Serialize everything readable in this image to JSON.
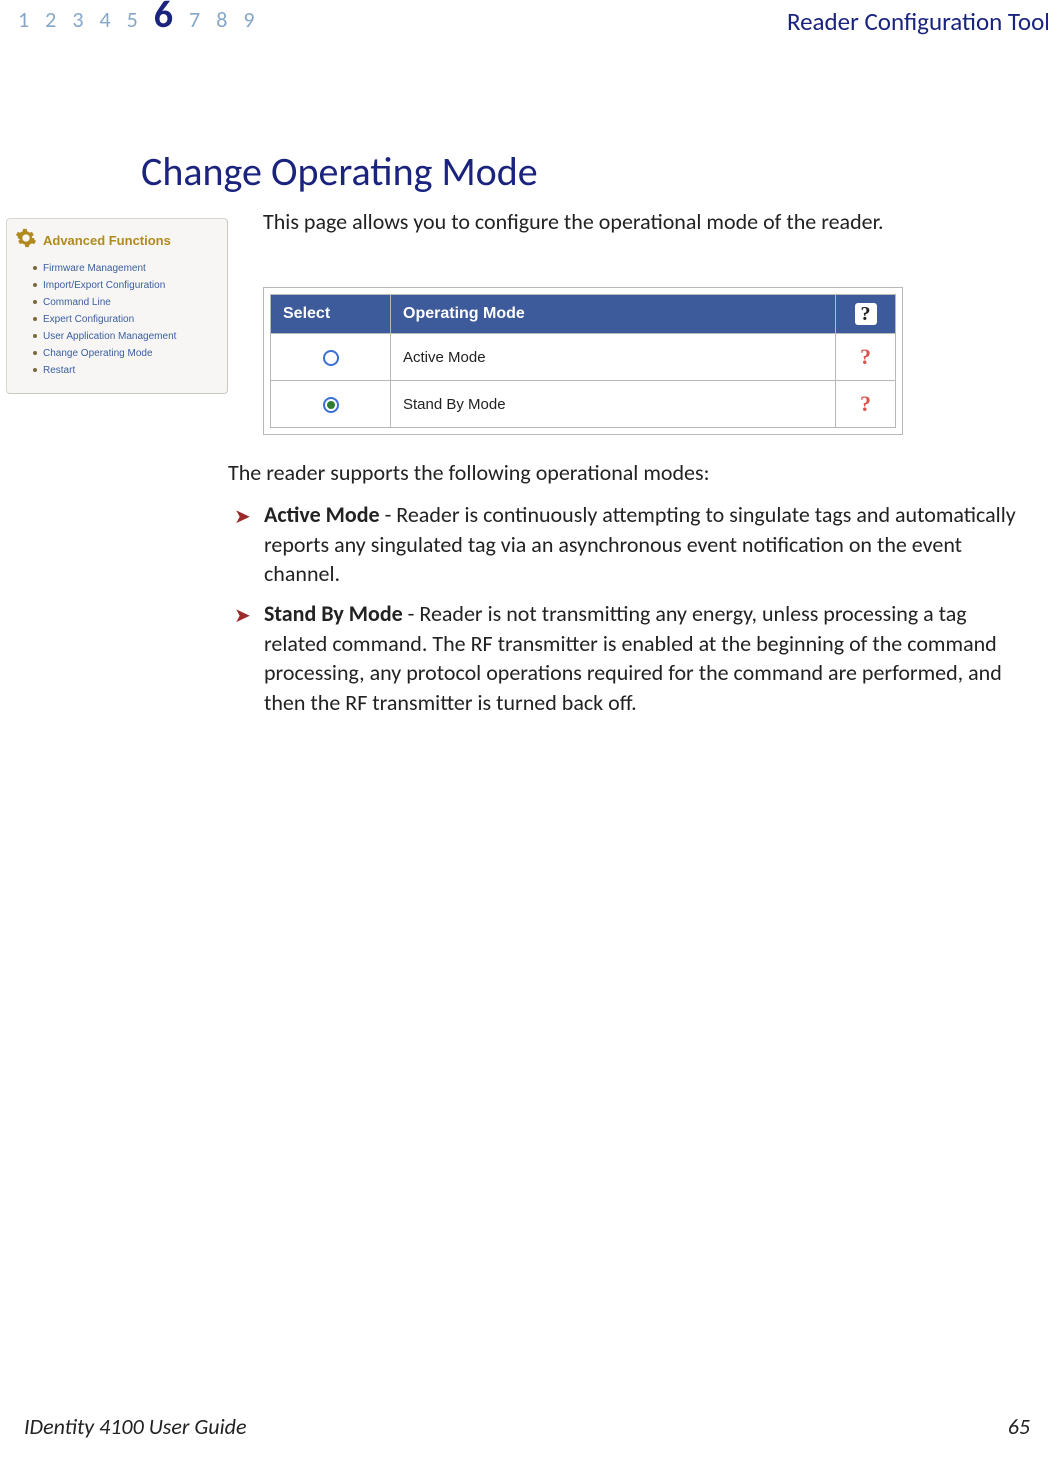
{
  "header": {
    "nums": [
      "1",
      "2",
      "3",
      "4",
      "5",
      "6",
      "7",
      "8",
      "9"
    ],
    "activeIndex": 5,
    "title": "Reader Configuration Tool"
  },
  "heading": "Change Operating Mode",
  "intro": "This page allows you to configure the operational mode of the reader.",
  "sidebar": {
    "title": "Advanced Functions",
    "items": [
      "Firmware Management",
      "Import/Export Configuration",
      "Command Line",
      "Expert Configuration",
      "User Application Management",
      "Change Operating Mode",
      "Restart"
    ]
  },
  "table": {
    "headers": {
      "select": "Select",
      "mode": "Operating Mode",
      "help": "?"
    },
    "rows": [
      {
        "selected": false,
        "mode": "Active Mode",
        "help": "?"
      },
      {
        "selected": true,
        "mode": "Stand By Mode",
        "help": "?"
      }
    ]
  },
  "supports_text": "The reader supports the following operational modes:",
  "bullets": [
    {
      "name": "Active Mode",
      "desc": " - Reader is continuously attempting to singulate tags and automatically reports any singulated tag via an asynchronous event notification on the event channel."
    },
    {
      "name": "Stand By Mode",
      "desc": " - Reader is not transmitting any energy, unless processing a tag related command. The RF transmitter is enabled at the beginning of the command processing, any protocol operations required for the command are performed, and then the RF transmitter is turned back off."
    }
  ],
  "footer": {
    "product_prefix": "ID",
    "product_rest": "entity 4100 User Guide",
    "page": "65"
  }
}
